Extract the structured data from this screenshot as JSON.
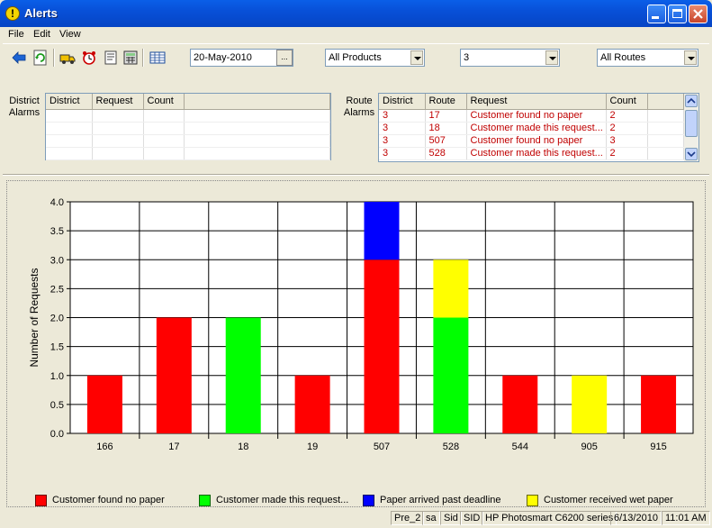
{
  "window": {
    "title": "Alerts"
  },
  "menu": [
    "File",
    "Edit",
    "View"
  ],
  "toolbar": {
    "date": "20-May-2010",
    "date_button": "...",
    "products": "All Products",
    "number": "3",
    "routes": "All Routes"
  },
  "district_alarms": {
    "label_1": "District",
    "label_2": "Alarms",
    "columns": [
      "District",
      "Request",
      "Count"
    ],
    "rows": []
  },
  "route_alarms": {
    "label_1": "Route",
    "label_2": "Alarms",
    "columns": [
      "District",
      "Route",
      "Request",
      "Count"
    ],
    "rows": [
      [
        "3",
        "17",
        "Customer found no paper",
        "2"
      ],
      [
        "3",
        "18",
        "Customer made this request...",
        "2"
      ],
      [
        "3",
        "507",
        "Customer found no paper",
        "3"
      ],
      [
        "3",
        "528",
        "Customer made this request...",
        "2"
      ]
    ]
  },
  "chart_data": {
    "type": "bar",
    "stacked": true,
    "ylabel": "Number of Requests",
    "ylim": [
      0,
      4
    ],
    "yticks": [
      "0.0",
      "0.5",
      "1.0",
      "1.5",
      "2.0",
      "2.5",
      "3.0",
      "3.5",
      "4.0"
    ],
    "categories": [
      "166",
      "17",
      "18",
      "19",
      "507",
      "528",
      "544",
      "905",
      "915"
    ],
    "grid": true,
    "legend_position": "bottom",
    "series": [
      {
        "name": "Customer found no paper",
        "color": "#ff0000",
        "values": [
          1,
          2,
          0,
          1,
          3,
          0,
          1,
          0,
          1
        ]
      },
      {
        "name": "Customer made this request...",
        "color": "#00ff00",
        "values": [
          0,
          0,
          2,
          0,
          0,
          2,
          0,
          0,
          0
        ]
      },
      {
        "name": "Paper arrived past deadline",
        "color": "#0000ff",
        "values": [
          0,
          0,
          0,
          0,
          1,
          0,
          0,
          0,
          0
        ]
      },
      {
        "name": "Customer received wet paper",
        "color": "#ffff00",
        "values": [
          0,
          0,
          0,
          0,
          0,
          1,
          0,
          1,
          0
        ]
      }
    ]
  },
  "statusbar": [
    "Pre_2",
    "sa",
    "Sid",
    "SID",
    "HP Photosmart C6200 series",
    "6/13/2010",
    "11:01 AM"
  ]
}
